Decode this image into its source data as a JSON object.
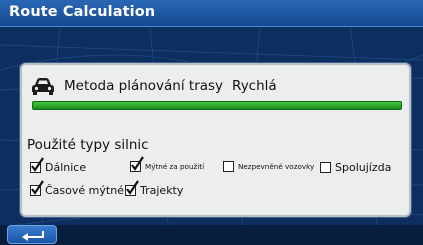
{
  "header": {
    "title": "Route Calculation"
  },
  "route": {
    "method_label": "Metoda plánování trasy",
    "method_value": "Rychlá",
    "progress_fraction": 1.0
  },
  "road_types": {
    "label": "Použité typy silnic",
    "options": [
      {
        "label": "Dálnice",
        "checked": true
      },
      {
        "label": "Mýtné za použití",
        "checked": true
      },
      {
        "label": "Nezpevněné vozovky",
        "checked": false
      },
      {
        "label": "Spolujízda",
        "checked": false
      },
      {
        "label": "Časové mýtné",
        "checked": true
      },
      {
        "label": "Trajekty",
        "checked": true
      }
    ]
  },
  "icons": {
    "vehicle": "car-icon",
    "back": "back-arrow-icon",
    "checkmark": "checkmark-icon"
  },
  "colors": {
    "title_bar": "#1f5aa6",
    "progress": "#2fb02f",
    "background": "#0d2f60"
  }
}
